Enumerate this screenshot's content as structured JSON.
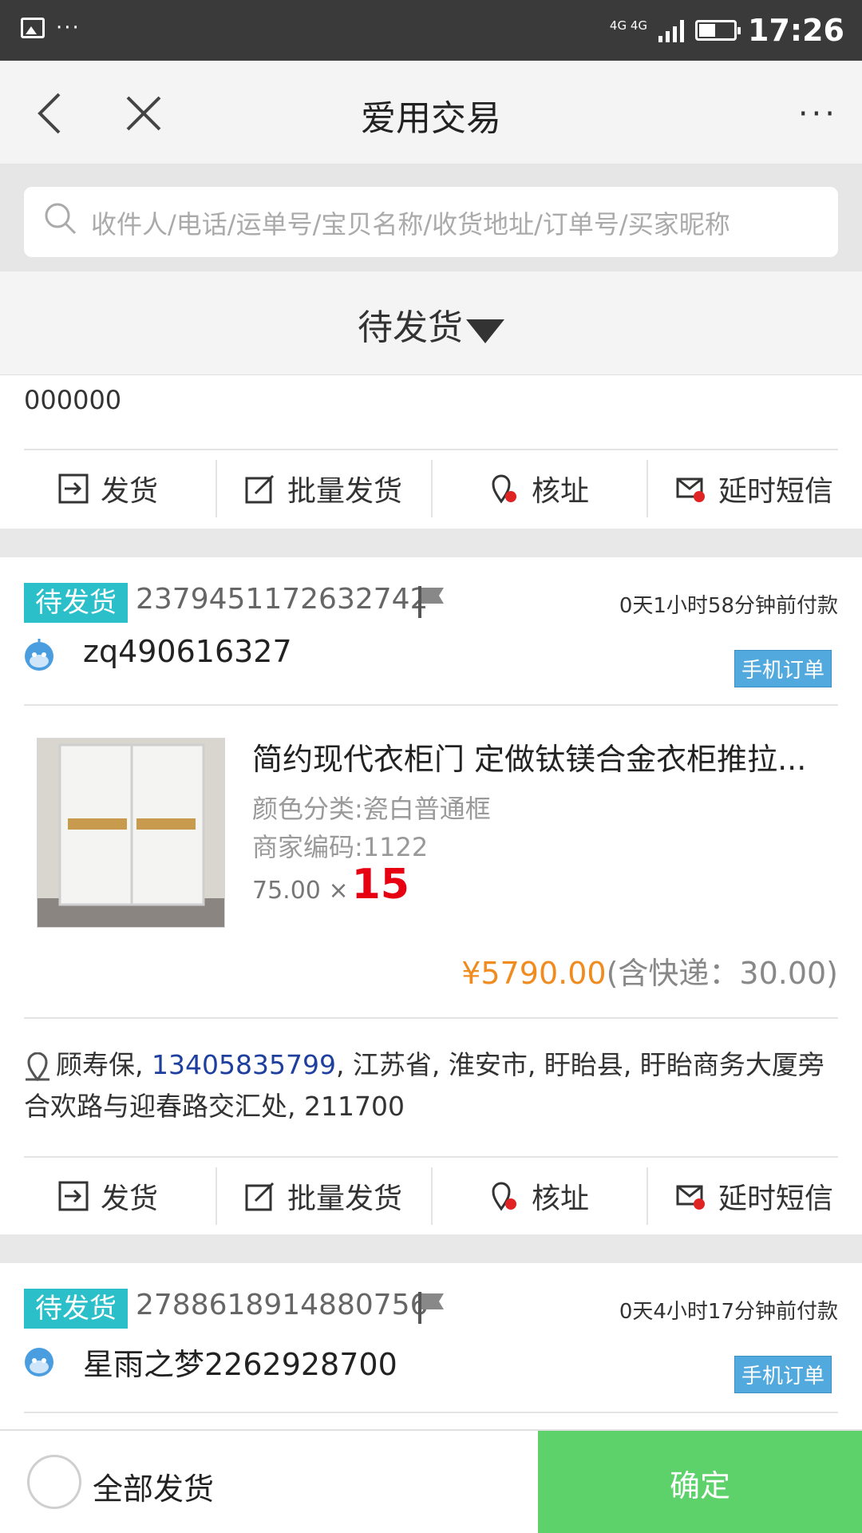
{
  "status_bar": {
    "network": "4G 4G",
    "time": "17:26",
    "notification": "···"
  },
  "nav": {
    "title": "爱用交易",
    "more": "···"
  },
  "search": {
    "placeholder": "收件人/电话/运单号/宝贝名称/收货地址/订单号/买家昵称"
  },
  "filter": {
    "label": "待发货"
  },
  "actions": [
    "发货",
    "批量发货",
    "核址",
    "延时短信"
  ],
  "prev_order": {
    "postal_code": "000000"
  },
  "orders": [
    {
      "status": "待发货",
      "order_no": "2379451172632742",
      "pay_time": "0天1小时58分钟前付款",
      "buyer": "zq490616327",
      "source_badge": "手机订单",
      "product_title": "简约现代衣柜门 定做钛镁合金衣柜推拉...",
      "attr_color": "颜色分类:瓷白普通框",
      "attr_code": "商家编码:1122",
      "unit_price": "75.00",
      "qty_sep": "×",
      "qty": "15",
      "total_amount": "¥5790.00",
      "shipping_note": "(含快递：30.00)",
      "addr_name": "顾寿保, ",
      "addr_phone": "13405835799",
      "addr_rest": ", 江苏省, 淮安市, 盱眙县, 盱眙商务大厦旁合欢路与迎春路交汇处, 211700"
    },
    {
      "status": "待发货",
      "order_no": "2788618914880756",
      "pay_time": "0天4小时17分钟前付款",
      "buyer": "星雨之梦2262928700",
      "source_badge": "手机订单"
    }
  ],
  "bottom": {
    "select_all": "全部发货",
    "confirm": "确定"
  },
  "colors": {
    "tag": "#2bbfc9",
    "badge": "#52a9dd",
    "confirm": "#5dd16a",
    "price": "#f08c1f",
    "qty": "#e60012"
  }
}
